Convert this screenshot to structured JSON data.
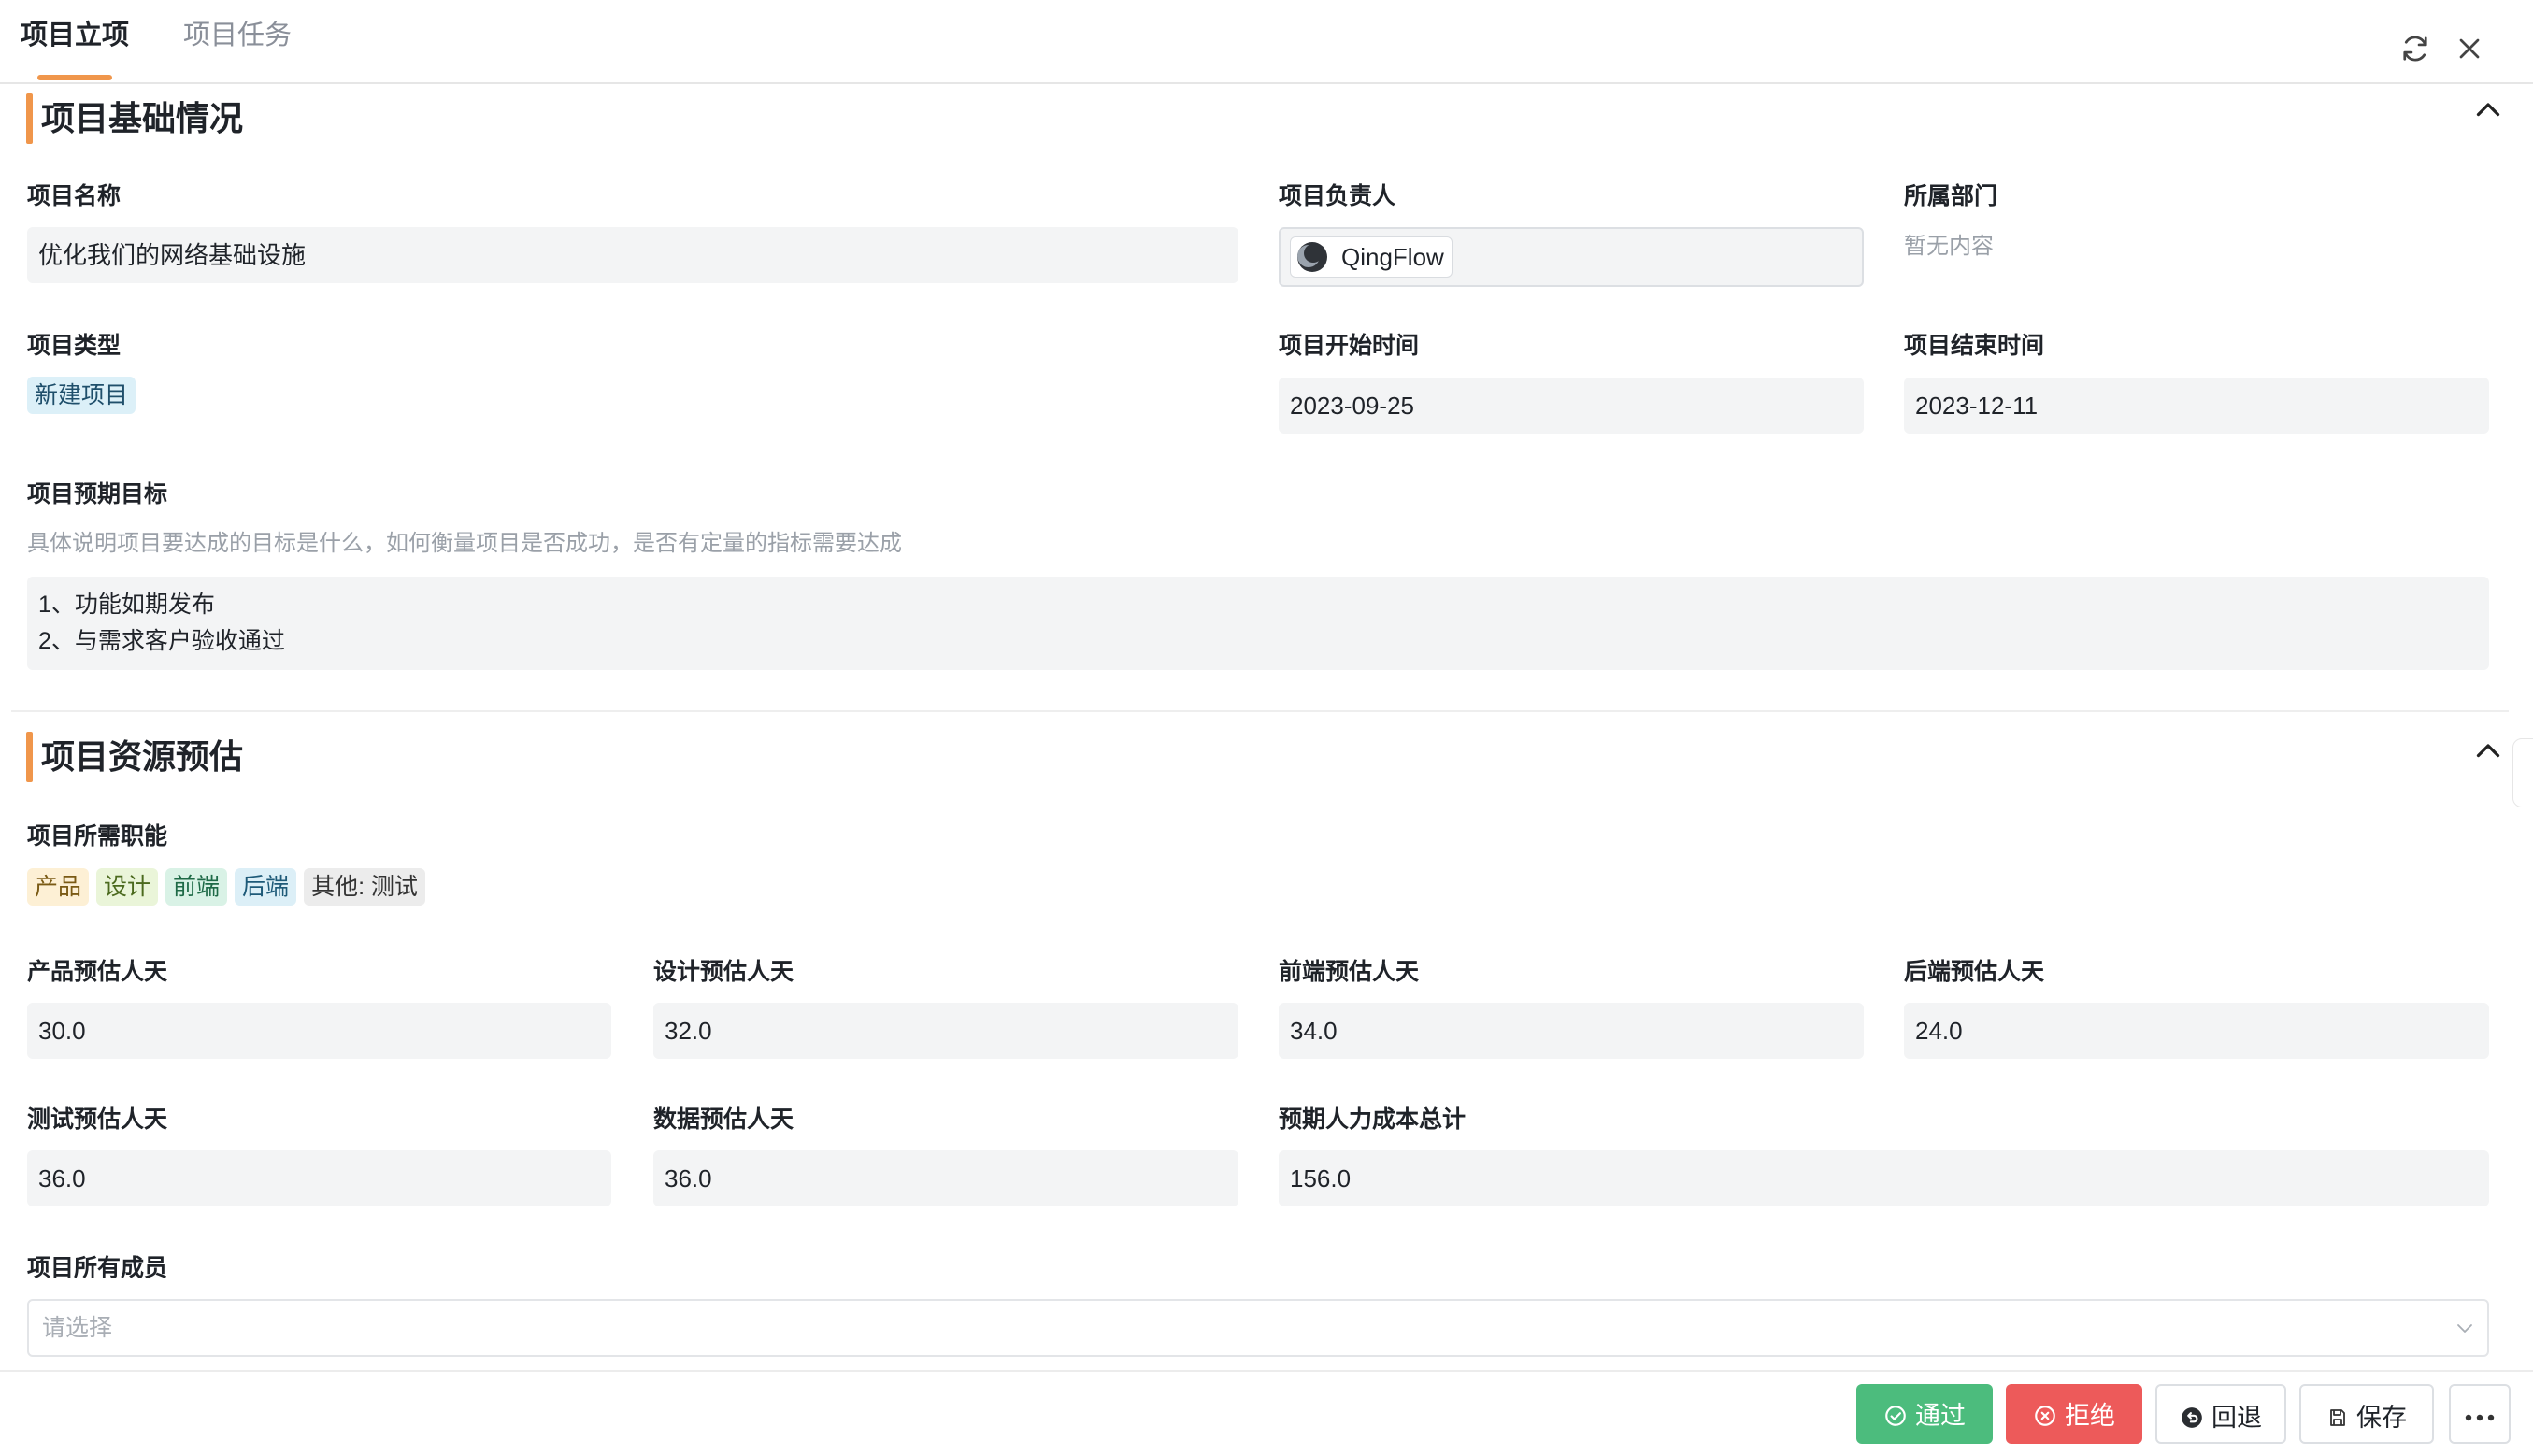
{
  "tabs": [
    {
      "label": "项目立项",
      "active": true
    },
    {
      "label": "项目任务",
      "active": false
    }
  ],
  "section1": {
    "title": "项目基础情况",
    "project_name": {
      "label": "项目名称",
      "value": "优化我们的网络基础设施"
    },
    "owner": {
      "label": "项目负责人",
      "value": "QingFlow"
    },
    "department": {
      "label": "所属部门",
      "value": "暂无内容"
    },
    "project_type": {
      "label": "项目类型",
      "value": "新建项目"
    },
    "start_date": {
      "label": "项目开始时间",
      "value": "2023-09-25"
    },
    "end_date": {
      "label": "项目结束时间",
      "value": "2023-12-11"
    },
    "goal": {
      "label": "项目预期目标",
      "hint": "具体说明项目要达成的目标是什么，如何衡量项目是否成功，是否有定量的指标需要达成",
      "line1": "1、功能如期发布",
      "line2": "2、与需求客户验收通过"
    }
  },
  "section2": {
    "title": "项目资源预估",
    "roles": {
      "label": "项目所需职能",
      "tags": [
        {
          "text": "产品",
          "bg": "#fdf0d5",
          "color": "#7a5a14"
        },
        {
          "text": "设计",
          "bg": "#eaf5d9",
          "color": "#4b6a1e"
        },
        {
          "text": "前端",
          "bg": "#d9f2e6",
          "color": "#1e6a47"
        },
        {
          "text": "后端",
          "bg": "#dceff7",
          "color": "#1e5a78"
        },
        {
          "text": "其他: 测试",
          "bg": "#ececec",
          "color": "#333333"
        }
      ]
    },
    "product_days": {
      "label": "产品预估人天",
      "value": "30.0"
    },
    "design_days": {
      "label": "设计预估人天",
      "value": "32.0"
    },
    "frontend_days": {
      "label": "前端预估人天",
      "value": "34.0"
    },
    "backend_days": {
      "label": "后端预估人天",
      "value": "24.0"
    },
    "test_days": {
      "label": "测试预估人天",
      "value": "36.0"
    },
    "data_days": {
      "label": "数据预估人天",
      "value": "36.0"
    },
    "total_cost": {
      "label": "预期人力成本总计",
      "value": "156.0"
    },
    "members": {
      "label": "项目所有成员",
      "placeholder": "请选择"
    }
  },
  "footer": {
    "approve": "通过",
    "reject": "拒绝",
    "back": "回退",
    "save": "保存"
  },
  "colors": {
    "accent": "#f0964b",
    "approve": "#4cbc7d",
    "reject": "#ed5a5a"
  }
}
